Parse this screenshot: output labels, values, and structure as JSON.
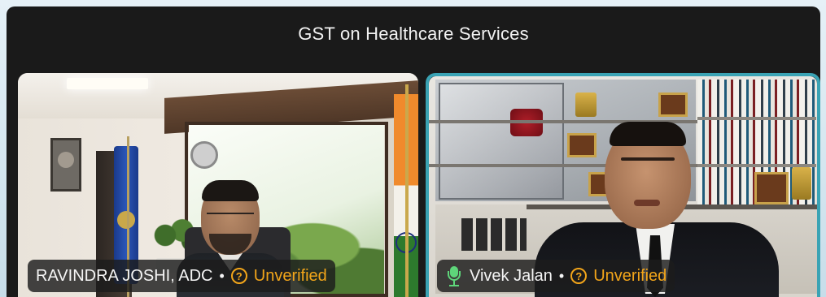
{
  "meeting": {
    "title": "GST on Healthcare Services"
  },
  "participants": [
    {
      "name": "RAVINDRA JOSHI, ADC",
      "separator": "•",
      "status_icon": "question-mark-circle-icon",
      "status_symbol": "?",
      "status_label": "Unverified",
      "active_speaker": false
    },
    {
      "name": "Vivek Jalan",
      "separator": "•",
      "status_icon": "question-mark-circle-icon",
      "status_symbol": "?",
      "status_label": "Unverified",
      "mic_icon": "microphone-icon",
      "active_speaker": true
    }
  ],
  "colors": {
    "background": "#1a1a1a",
    "active_speaker_border": "#3aa3b4",
    "unverified_accent": "#f2a51a",
    "mic_active": "#5ed67a"
  }
}
